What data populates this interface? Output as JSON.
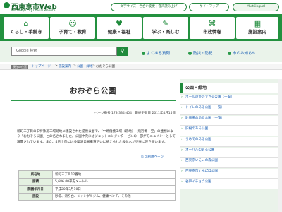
{
  "header": {
    "logo_title": "西東京市Web",
    "logo_sub": "Nishitokyo City Official Website",
    "text_button": "文字サイズ・色合い変更 | 音声読み上げ",
    "sitemap_button": "サイトマップ",
    "lang_button": "Multilingual"
  },
  "nav": [
    {
      "icon": "⌂",
      "label": "くらし・手続き"
    },
    {
      "icon": "☺",
      "label": "子育て・教育"
    },
    {
      "icon": "♥",
      "label": "健康・福祉"
    },
    {
      "icon": "✎",
      "label": "学ぶ・楽しむ"
    },
    {
      "icon": "⌘",
      "label": "市政情報"
    },
    {
      "icon": "▦",
      "label": "施設案内"
    }
  ],
  "search": {
    "placeholder": "Google 検索",
    "button_icon": "search-icon"
  },
  "quick_links": [
    "よくある質問",
    "防災・防犯",
    "市のお知らせ"
  ],
  "breadcrumb": {
    "label": "現在の位置",
    "items": [
      "トップページ",
      "施設案内",
      "公園・緑地",
      "おおぞら公園"
    ]
  },
  "page": {
    "title": "おおぞら公園",
    "meta": "ページ番号 178-334-404　最終更新日 2011年4月15日",
    "intro": "新町三丁目の旧特殊施工場跡地に建設された提供公園で、「中嶋飛機工場（跡地）→飛行機一空」の連想により「おおぞら公園」と命名されました。公園中央にはジェットエンジンタービンの一部がモニュメントとして設置されています。また、4月上旬には多摩湖自転車道沿いに植えられた桜並木が見事に咲き揃います。",
    "print_link": "印刷用ページ"
  },
  "info_table": [
    {
      "label": "所在地",
      "value": "新町三丁目12番地"
    },
    {
      "label": "面積",
      "value": "5,686.00平方メートル"
    },
    {
      "label": "開園年月日",
      "value": "平成20年3月10日"
    },
    {
      "label": "施設",
      "value": "砂場、滑り台、ジャングルジム、健康ベンチ、その他"
    }
  ],
  "sidebar": {
    "title": "公園・緑地",
    "items": [
      "ボール遊びのできる公園（一覧）",
      "トイレのある公園（一覧）",
      "駐車場のある公園（一覧）",
      "旧樹のある公園",
      "うめでのある公園",
      "オーバルのある公園",
      "西東京いこいの森公園",
      "西東京市たんぽぽ公園",
      "谷戸イチョウ公園"
    ]
  }
}
